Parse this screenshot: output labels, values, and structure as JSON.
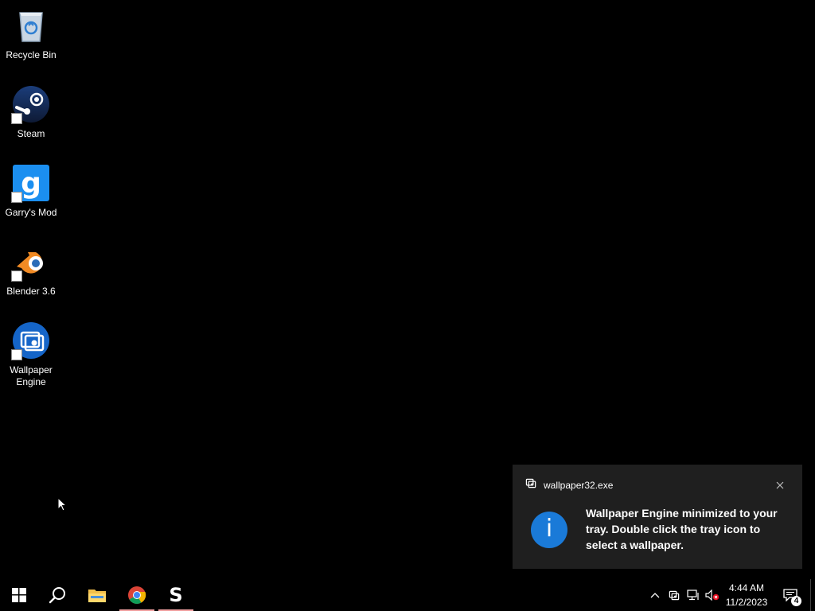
{
  "desktop": {
    "icons": [
      {
        "label": "Recycle Bin"
      },
      {
        "label": "Steam"
      },
      {
        "label": "Garry's Mod"
      },
      {
        "label": "Blender 3.6"
      },
      {
        "label": "Wallpaper Engine"
      }
    ]
  },
  "toast": {
    "app_name": "wallpaper32.exe",
    "message": "Wallpaper Engine minimized to your tray. Double click the tray icon to select a wallpaper.",
    "info_glyph": "i"
  },
  "taskbar": {
    "apps": [
      {
        "name": "start-button",
        "icon": "windows-logo-icon"
      },
      {
        "name": "search-button",
        "icon": "search-icon"
      },
      {
        "name": "file-explorer",
        "icon": "folder-icon"
      },
      {
        "name": "chrome",
        "icon": "chrome-icon"
      },
      {
        "name": "app-s",
        "icon": "s-app-icon",
        "glyph": "S"
      }
    ],
    "clock": {
      "time": "4:44 AM",
      "date": "11/2/2023"
    },
    "notification_count": "4"
  },
  "colors": {
    "background": "#000000",
    "toast_background": "#1f1f1f",
    "info_blue": "#1a7ad8",
    "active_indicator": "#f0a0a0"
  }
}
